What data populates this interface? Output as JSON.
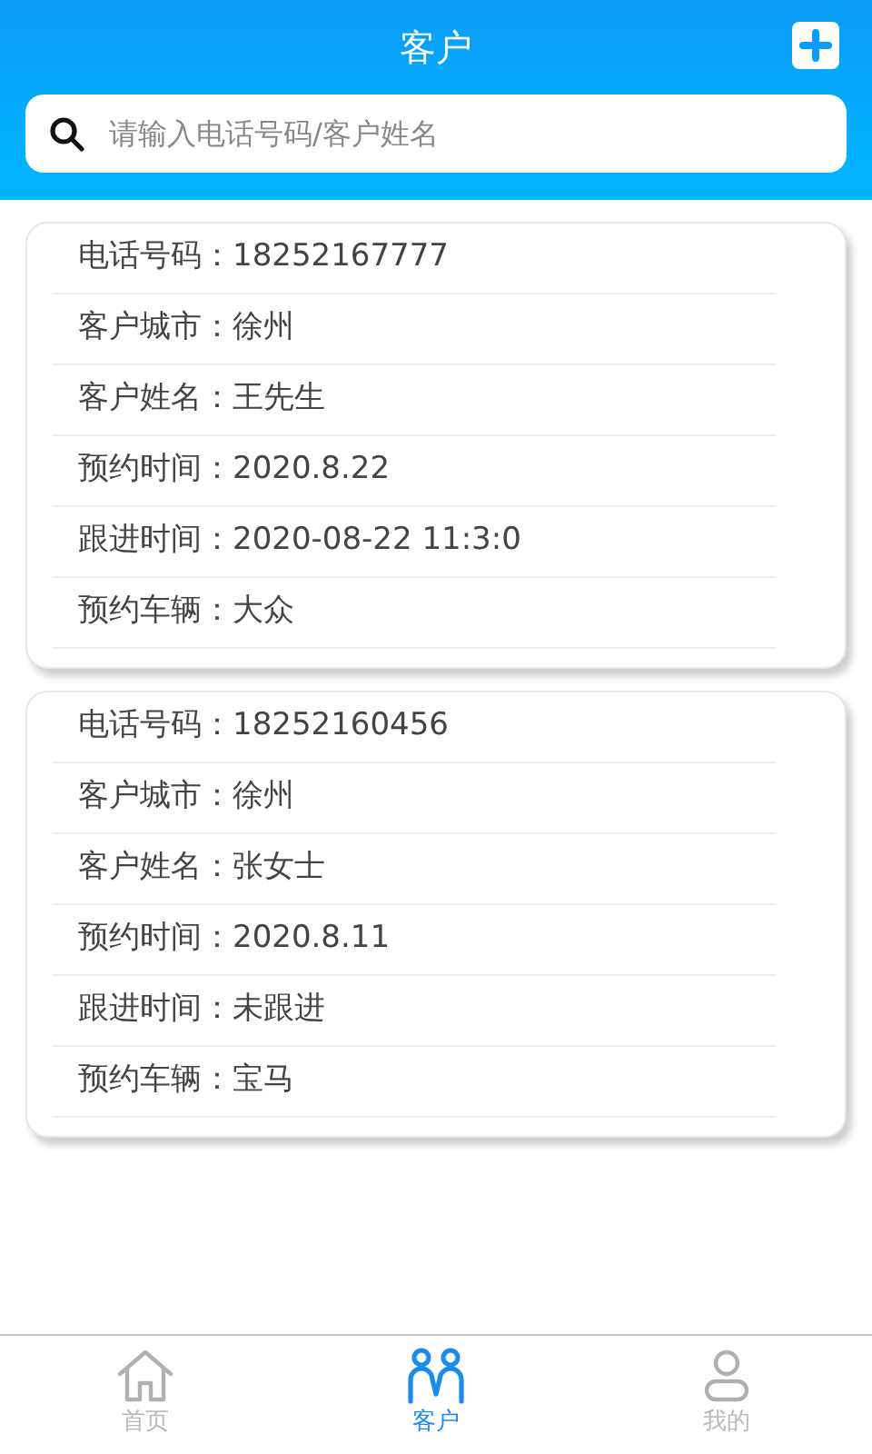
{
  "header": {
    "title": "客户"
  },
  "search": {
    "placeholder": "请输入电话号码/客户姓名"
  },
  "customers": [
    {
      "fields": [
        {
          "label": "电话号码：",
          "value": "18252167777"
        },
        {
          "label": "客户城市：",
          "value": "徐州"
        },
        {
          "label": "客户姓名：",
          "value": "王先生"
        },
        {
          "label": "预约时间：",
          "value": "2020.8.22"
        },
        {
          "label": "跟进时间：",
          "value": "2020-08-22 11:3:0"
        },
        {
          "label": "预约车辆：",
          "value": "大众"
        }
      ]
    },
    {
      "fields": [
        {
          "label": "电话号码：",
          "value": "18252160456"
        },
        {
          "label": "客户城市：",
          "value": "徐州"
        },
        {
          "label": "客户姓名：",
          "value": "张女士"
        },
        {
          "label": "预约时间：",
          "value": "2020.8.11"
        },
        {
          "label": "跟进时间：",
          "value": "未跟进"
        },
        {
          "label": "预约车辆：",
          "value": "宝马"
        }
      ]
    }
  ],
  "tabs": [
    {
      "kind": "home",
      "label": "首页",
      "selected": false
    },
    {
      "kind": "customers",
      "label": "客户",
      "selected": true
    },
    {
      "kind": "me",
      "label": "我的",
      "selected": false
    }
  ]
}
